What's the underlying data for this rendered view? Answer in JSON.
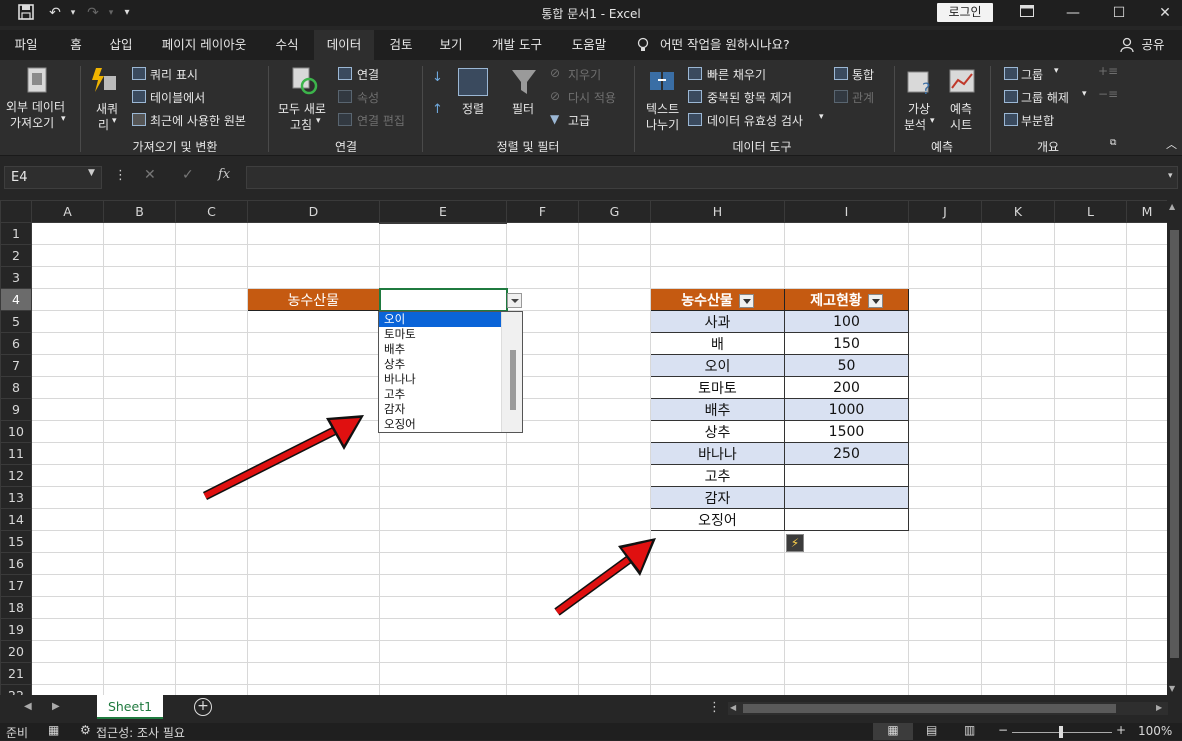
{
  "titlebar": {
    "title": "통합 문서1  -  Excel",
    "login": "로그인",
    "qat": [
      "save-icon",
      "undo-icon",
      "redo-icon",
      "customize-icon"
    ]
  },
  "tabs": [
    "파일",
    "홈",
    "삽입",
    "페이지 레이아웃",
    "수식",
    "데이터",
    "검토",
    "보기",
    "개발 도구",
    "도움말"
  ],
  "active_tab": "데이터",
  "tell_me": "어떤 작업을 원하시나요?",
  "share": "공유",
  "ribbon": {
    "get_external_1": "외부 데이터",
    "get_external_2": "가져오기",
    "new_query_1": "새쿼",
    "new_query_2": "리",
    "show_queries": "쿼리 표시",
    "from_table": "테이블에서",
    "recent_sources": "최근에 사용한 원본",
    "group_get": "가져오기 및 변환",
    "refresh_1": "모두 새로",
    "refresh_2": "고침",
    "connections": "연결",
    "properties": "속성",
    "edit_links": "연결 편집",
    "group_conn": "연결",
    "sort": "정렬",
    "filter": "필터",
    "clear": "지우기",
    "reapply": "다시 적용",
    "advanced": "고급",
    "group_sort": "정렬 및 필터",
    "text_cols_1": "텍스트",
    "text_cols_2": "나누기",
    "flash_fill": "빠른 채우기",
    "remove_dup": "중복된 항목 제거",
    "data_validation": "데이터 유효성 검사",
    "consolidate": "통합",
    "relationships": "관계",
    "group_tools": "데이터 도구",
    "whatif_1": "가상",
    "whatif_2": "분석",
    "forecast_1": "예측",
    "forecast_2": "시트",
    "group_forecast": "예측",
    "group": "그룹",
    "ungroup": "그룹 해제",
    "subtotal": "부분합",
    "group_outline": "개요"
  },
  "formula_bar": {
    "name_box": "E4",
    "fx": "fx",
    "value": ""
  },
  "columns": [
    "A",
    "B",
    "C",
    "D",
    "E",
    "F",
    "G",
    "H",
    "I",
    "J",
    "K",
    "L",
    "M"
  ],
  "rows": [
    "1",
    "2",
    "3",
    "4",
    "5",
    "6",
    "7",
    "8",
    "9",
    "10",
    "11",
    "12",
    "13",
    "14",
    "15",
    "16",
    "17",
    "18",
    "19",
    "20",
    "21",
    "22"
  ],
  "cells": {
    "D4": "농수산물",
    "H4": "농수산물",
    "I4": "제고현황"
  },
  "table": [
    {
      "name": "사과",
      "stock": "100"
    },
    {
      "name": "배",
      "stock": "150"
    },
    {
      "name": "오이",
      "stock": "50"
    },
    {
      "name": "토마토",
      "stock": "200"
    },
    {
      "name": "배추",
      "stock": "1000"
    },
    {
      "name": "상추",
      "stock": "1500"
    },
    {
      "name": "바나나",
      "stock": "250"
    },
    {
      "name": "고추",
      "stock": ""
    },
    {
      "name": "감자",
      "stock": ""
    },
    {
      "name": "오징어",
      "stock": ""
    }
  ],
  "dropdown": {
    "items": [
      "오이",
      "토마토",
      "배추",
      "상추",
      "바나나",
      "고추",
      "감자",
      "오징어"
    ],
    "selected": "오이"
  },
  "sheet_tab": "Sheet1",
  "status": {
    "ready": "준비",
    "accessibility": "접근성: 조사 필요",
    "zoom": "100%"
  },
  "colors": {
    "header_orange": "#c55a11",
    "band_blue": "#d9e1f2",
    "select_blue": "#0a64d8",
    "excel_green": "#1f7a3f",
    "arrow_red": "#e01010"
  }
}
